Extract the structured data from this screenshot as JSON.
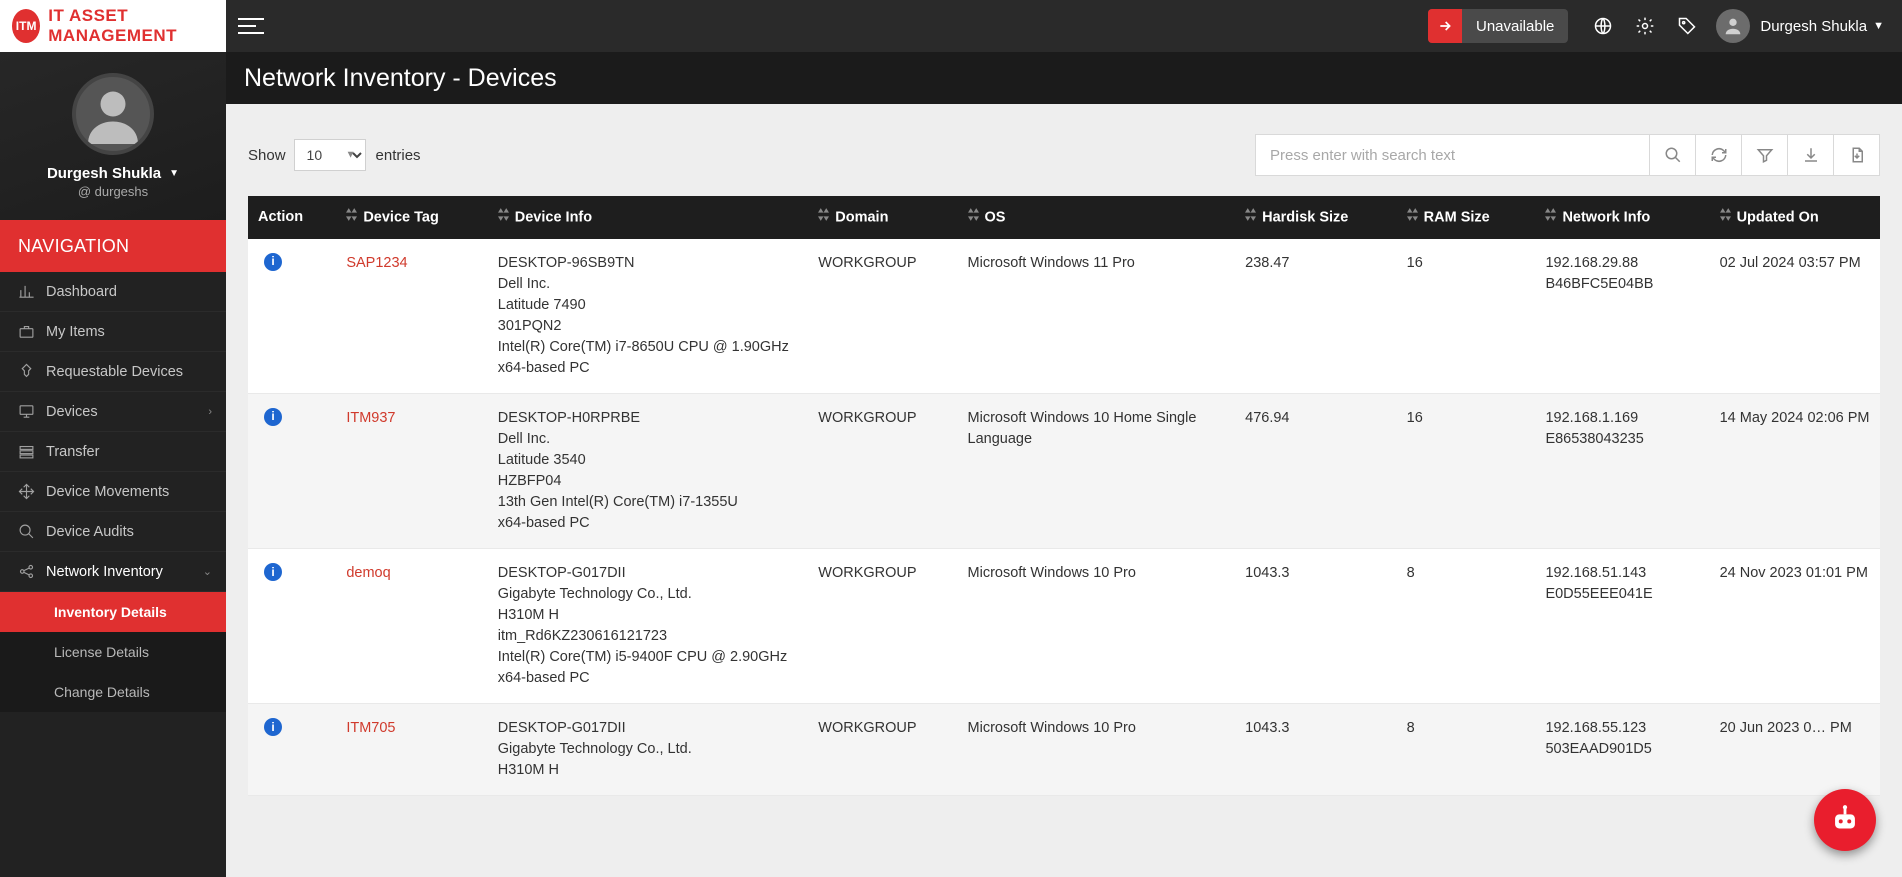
{
  "brand": {
    "badge": "ITM",
    "name": "IT ASSET MANAGEMENT"
  },
  "topbar": {
    "unavailable_label": "Unavailable",
    "user_name": "Durgesh Shukla"
  },
  "page_title": "Network Inventory - Devices",
  "profile": {
    "name": "Durgesh Shukla",
    "handle": "@ durgeshs"
  },
  "nav": {
    "header": "NAVIGATION",
    "items": [
      {
        "icon": "chart",
        "label": "Dashboard"
      },
      {
        "icon": "briefcase",
        "label": "My Items"
      },
      {
        "icon": "pin",
        "label": "Requestable Devices"
      },
      {
        "icon": "monitor",
        "label": "Devices",
        "has_children": true
      },
      {
        "icon": "rows",
        "label": "Transfer"
      },
      {
        "icon": "move",
        "label": "Device Movements"
      },
      {
        "icon": "search",
        "label": "Device Audits"
      },
      {
        "icon": "share",
        "label": "Network Inventory",
        "has_children": true,
        "expanded": true
      }
    ],
    "sub": [
      {
        "label": "Inventory Details",
        "active": true
      },
      {
        "label": "License Details"
      },
      {
        "label": "Change Details"
      }
    ]
  },
  "table_controls": {
    "show": "Show",
    "page_size": "10",
    "entries": "entries",
    "search_placeholder": "Press enter with search text"
  },
  "columns": {
    "action": "Action",
    "tag": "Device Tag",
    "info": "Device Info",
    "domain": "Domain",
    "os": "OS",
    "hd": "Hardisk Size",
    "ram": "RAM Size",
    "net": "Network Info",
    "upd": "Updated On"
  },
  "rows": [
    {
      "tag": "SAP1234",
      "info": "DESKTOP-96SB9TN\nDell Inc.\nLatitude 7490\n301PQN2\nIntel(R) Core(TM) i7-8650U CPU @ 1.90GHz\nx64-based PC",
      "domain": "WORKGROUP",
      "os": "Microsoft Windows 11 Pro",
      "hd": "238.47",
      "ram": "16",
      "net": "192.168.29.88\nB46BFC5E04BB",
      "upd": "02 Jul 2024 03:57 PM"
    },
    {
      "tag": "ITM937",
      "info": "DESKTOP-H0RPRBE\nDell Inc.\nLatitude 3540\nHZBFP04\n13th Gen Intel(R) Core(TM) i7-1355U\nx64-based PC",
      "domain": "WORKGROUP",
      "os": "Microsoft Windows 10 Home Single Language",
      "hd": "476.94",
      "ram": "16",
      "net": "192.168.1.169\nE86538043235",
      "upd": "14 May 2024 02:06 PM"
    },
    {
      "tag": "demoq",
      "info": "DESKTOP-G017DII\nGigabyte Technology Co., Ltd.\nH310M H\nitm_Rd6KZ230616121723\nIntel(R) Core(TM) i5-9400F CPU @ 2.90GHz\nx64-based PC",
      "domain": "WORKGROUP",
      "os": "Microsoft Windows 10 Pro",
      "hd": "1043.3",
      "ram": "8",
      "net": "192.168.51.143\nE0D55EEE041E",
      "upd": "24 Nov 2023 01:01 PM"
    },
    {
      "tag": "ITM705",
      "info": "DESKTOP-G017DII\nGigabyte Technology Co., Ltd.\nH310M H",
      "domain": "WORKGROUP",
      "os": "Microsoft Windows 10 Pro",
      "hd": "1043.3",
      "ram": "8",
      "net": "192.168.55.123\n503EAAD901D5",
      "upd": "20 Jun 2023 0… PM"
    }
  ]
}
